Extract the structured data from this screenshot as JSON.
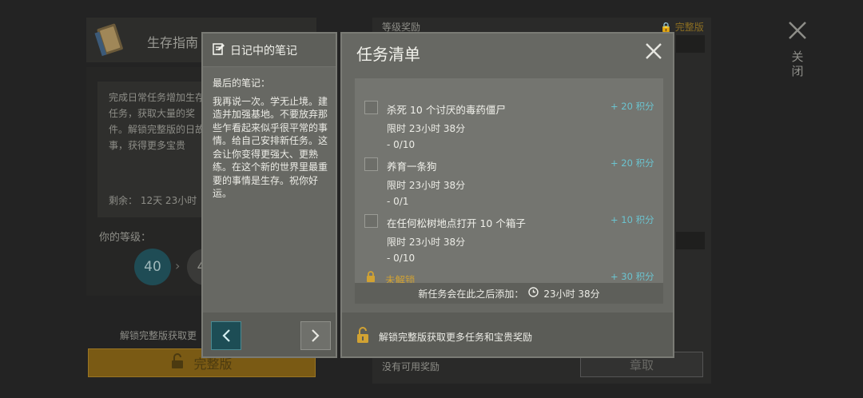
{
  "background": {
    "left_title": "生存指南",
    "left_desc": "完成日常任务增加生存任务，获取大量的奖件。解锁完整版的日故事，获得更多宝贵",
    "remaining_label": "剩余：",
    "remaining_value": "12天 23小时",
    "level_label": "你的等级：",
    "current_level": "40",
    "next_level": "4",
    "unlock_text": "解锁完整版获取更",
    "full_version_button": "完整版",
    "right_header": "等级奖励",
    "full_version_badge": "完整版",
    "no_reward_text": "没有可用奖励",
    "claim_button": "章取"
  },
  "close_label": "关闭",
  "diary": {
    "title": "日记中的笔记",
    "label": "最后的笔记：",
    "text": "我再说一次。学无止境。建造并加强基地。不要放弃那些乍看起来似乎很平常的事情。给自己安排新任务。这会让你变得更强大、更熟练。在这个新的世界里最重要的事情是生存。祝你好运。"
  },
  "tasks_panel": {
    "title": "任务清单",
    "tasks": [
      {
        "title": "杀死 10 个讨厌的毒药僵尸",
        "time": "限时 23小时 38分",
        "progress": "- 0/10",
        "points": "+ 20  积分"
      },
      {
        "title": "养育一条狗",
        "time": "限时 23小时 38分",
        "progress": "- 0/1",
        "points": "+ 20  积分"
      },
      {
        "title": "在任何松树地点打开 10 个箱子",
        "time": "限时 23小时 38分",
        "progress": "- 0/10",
        "points": "+ 10  积分"
      }
    ],
    "locked": {
      "text": "未解锁",
      "points": "+ 30  积分"
    },
    "new_task_text": "新任务会在此之后添加：",
    "new_task_time": "23小时 38分",
    "unlock_text": "解锁完整版获取更多任务和宝贵奖励"
  },
  "colors": {
    "accent_teal": "#6bc3cf",
    "gold": "#d1a233",
    "panel": "#676863"
  }
}
